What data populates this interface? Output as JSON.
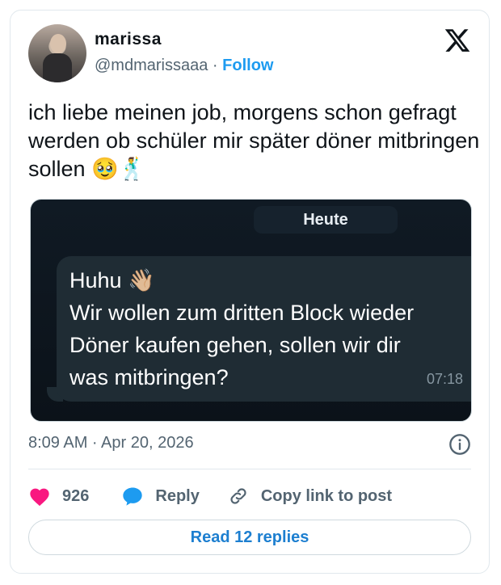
{
  "author": {
    "name": "marissa",
    "handle": "@mdmarissaaa",
    "separator": "·",
    "follow_label": "Follow"
  },
  "tweet": {
    "text": "ich liebe meinen job, morgens schon gefragt werden ob schüler mir später döner mitbringen sollen 🥹🕺"
  },
  "media": {
    "date_chip": "Heute",
    "message_lines": [
      "Huhu 👋🏼",
      "Wir wollen zum dritten Block wieder",
      "Döner kaufen gehen, sollen wir dir",
      "was mitbringen?"
    ],
    "time": "07:18"
  },
  "meta": {
    "timestamp": "8:09 AM · Apr 20, 2026"
  },
  "actions": {
    "likes": "926",
    "reply_label": "Reply",
    "copy_label": "Copy link to post"
  },
  "read_replies_label": "Read 12 replies",
  "colors": {
    "accent": "#1d9bf0",
    "like": "#f91880",
    "muted": "#536471"
  },
  "icons": {
    "logo": "x-logo-icon",
    "info": "info-icon",
    "like": "heart-icon",
    "reply": "reply-bubble-icon",
    "copy": "link-icon"
  }
}
